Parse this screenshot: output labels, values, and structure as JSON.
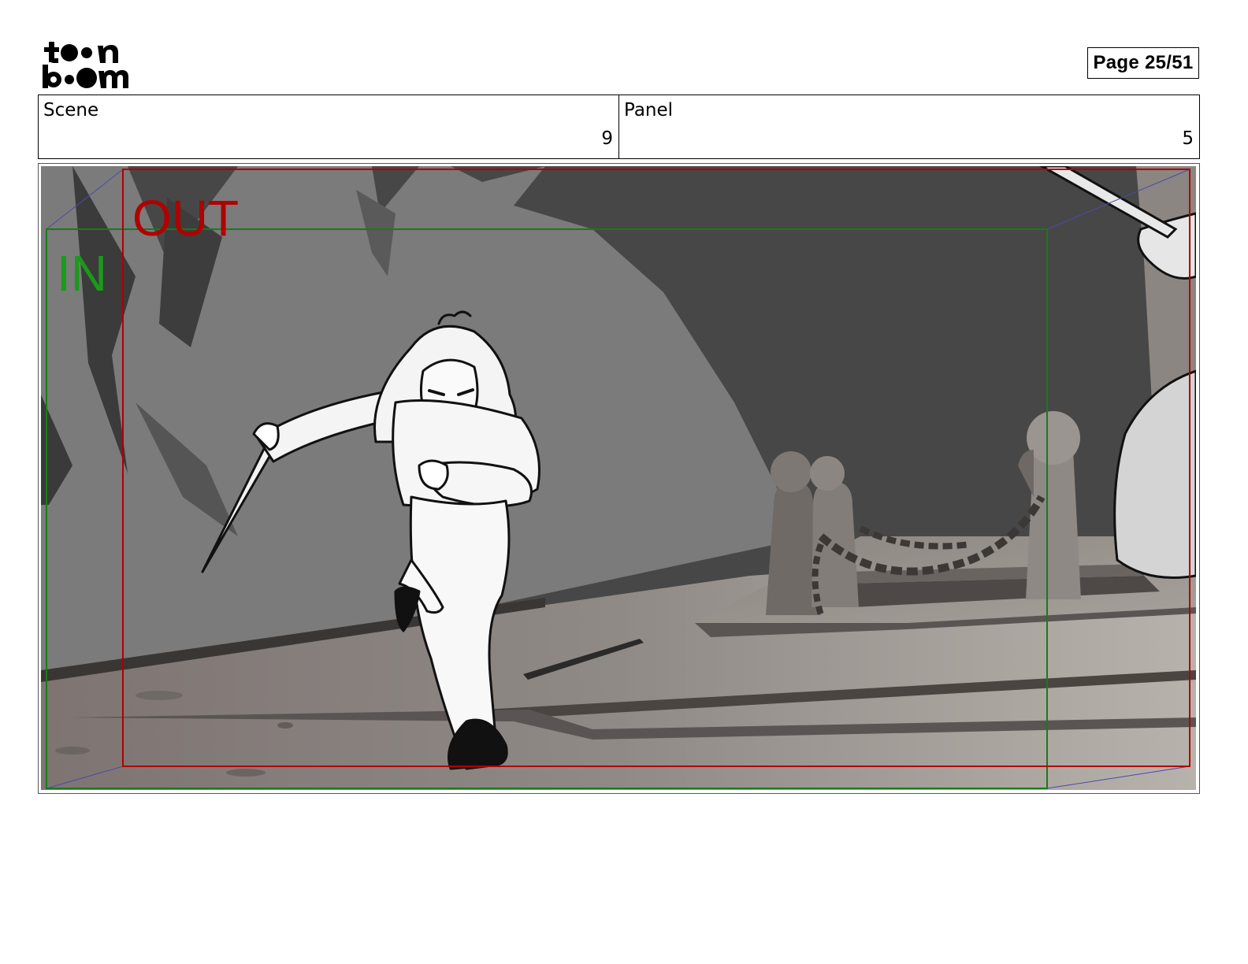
{
  "header": {
    "logo_top": "t●●n",
    "logo_bottom": "b●●m",
    "page_label": "Page 25/51"
  },
  "info": {
    "scene_label": "Scene",
    "scene_value": "9",
    "panel_label": "Panel",
    "panel_value": "5"
  },
  "panel": {
    "frame_in_label": "IN",
    "frame_out_label": "OUT",
    "colors": {
      "in_frame": "#1a8a1a",
      "out_frame": "#b00000",
      "sky": "#474747",
      "rock": "#7a7a7a",
      "deck": "#8e8a86"
    }
  }
}
